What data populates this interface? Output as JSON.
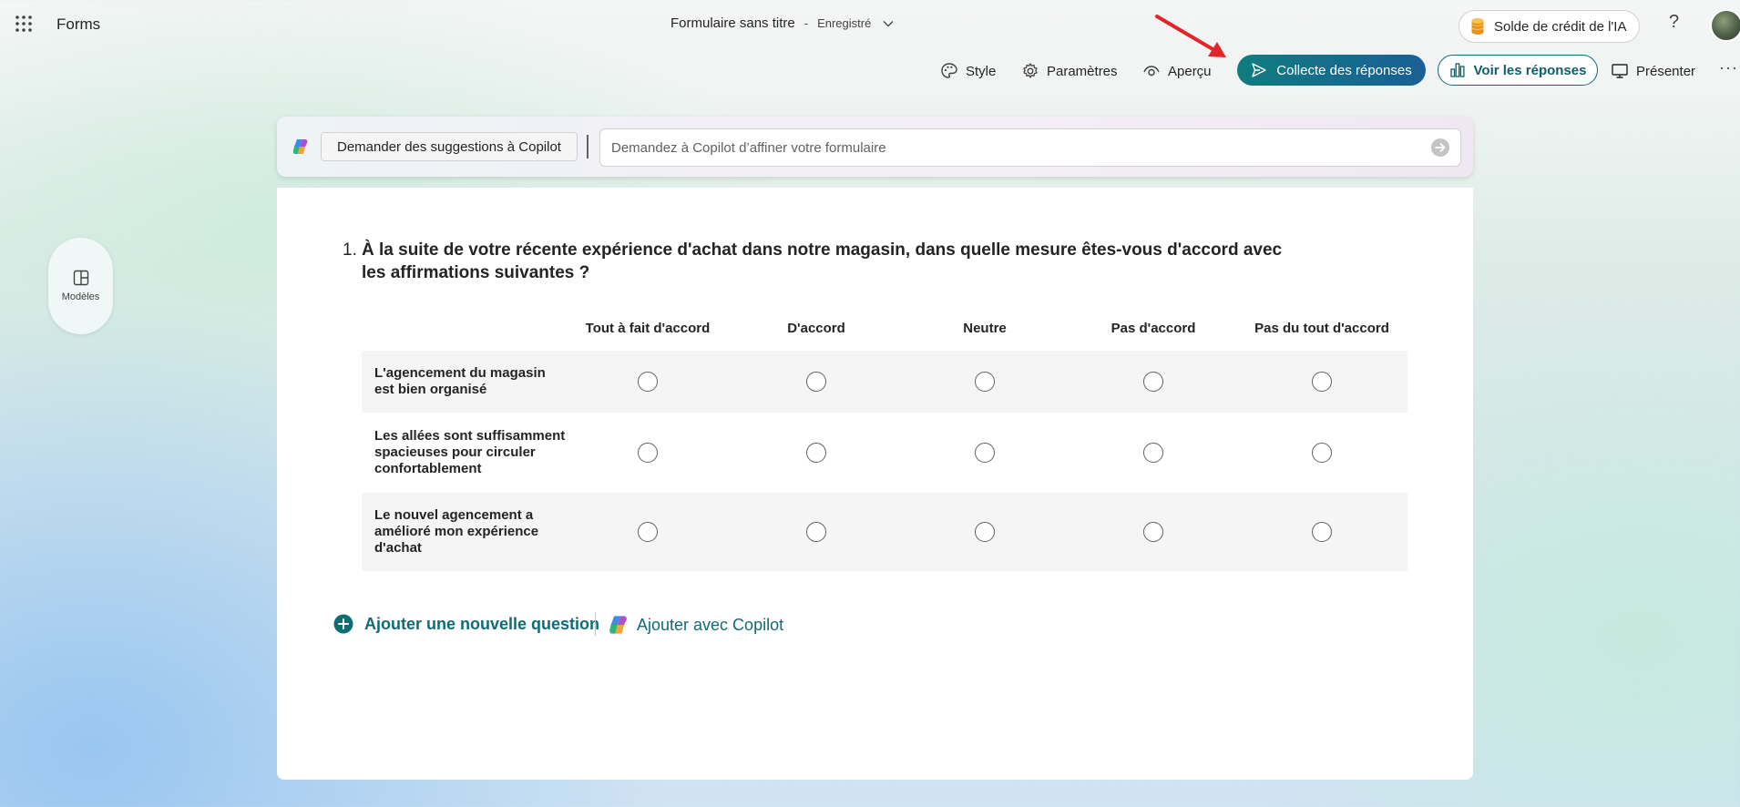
{
  "header": {
    "app_name": "Forms",
    "doc_title": "Formulaire sans titre",
    "separator": "-",
    "save_status": "Enregistré",
    "credit_label": "Solde de crédit de l'IA",
    "help_label": "?"
  },
  "toolbar": {
    "style": "Style",
    "settings": "Paramètres",
    "preview": "Aperçu",
    "collect": "Collecte des réponses",
    "view_responses": "Voir les réponses",
    "present": "Présenter",
    "more": "···"
  },
  "copilot": {
    "suggest_label": "Demander des suggestions à Copilot",
    "input_placeholder": "Demandez à Copilot d’affiner votre formulaire"
  },
  "sidebar": {
    "templates_label": "Modèles"
  },
  "question": {
    "number": "1.",
    "title": "À la suite de votre récente expérience d'achat dans notre magasin, dans quelle mesure êtes-vous d'accord avec les affirmations suivantes ?",
    "columns": [
      "Tout à fait d'accord",
      "D'accord",
      "Neutre",
      "Pas d'accord",
      "Pas du tout d'accord"
    ],
    "rows": [
      "L'agencement du magasin est bien organisé",
      "Les allées sont suffisamment spacieuses pour circuler confortablement",
      "Le nouvel agencement a amélioré mon expérience d'achat"
    ]
  },
  "actions": {
    "add_question": "Ajouter une nouvelle question",
    "add_copilot": "Ajouter avec Copilot"
  },
  "colors": {
    "accent": "#0f6c74",
    "collect_start": "#107c80",
    "collect_end": "#1a5f96",
    "annotation_arrow": "#e3242b"
  }
}
